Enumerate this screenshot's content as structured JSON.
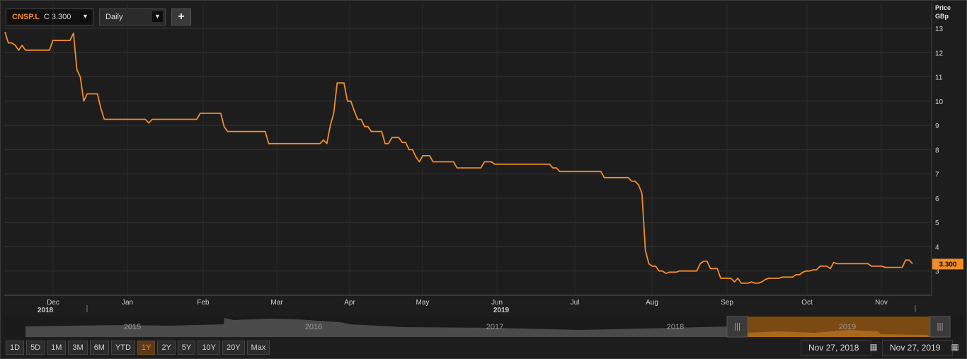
{
  "toolbar": {
    "symbol": "CNSP.L",
    "close_prefix": "C",
    "close_value": "3.300",
    "interval": "Daily",
    "add_label": "+"
  },
  "axis_header": {
    "line1": "Price",
    "line2": "GBp"
  },
  "navigator": {
    "years": [
      "2015",
      "2016",
      "2017",
      "2018",
      "2019"
    ]
  },
  "range_buttons": [
    "1D",
    "5D",
    "1M",
    "3M",
    "6M",
    "YTD",
    "1Y",
    "2Y",
    "5Y",
    "10Y",
    "20Y",
    "Max"
  ],
  "active_range": "1Y",
  "date_range": {
    "start": "Nov 27, 2018",
    "end": "Nov 27, 2019"
  },
  "colors": {
    "series": "#f28c28",
    "background": "#1d1d1d",
    "grid": "#333333"
  },
  "icons": [
    "dropdown-arrow-icon",
    "plus-icon",
    "calendar-icon",
    "navigator-handle-icon"
  ],
  "chart_data": {
    "type": "line",
    "title": "",
    "xlabel": "",
    "ylabel": "Price GBp",
    "ylim": [
      2,
      13
    ],
    "yticks": [
      3,
      4,
      5,
      6,
      7,
      8,
      9,
      10,
      11,
      12,
      13
    ],
    "month_ticks": [
      "Dec",
      "Jan",
      "Feb",
      "Mar",
      "Apr",
      "May",
      "Jun",
      "Jul",
      "Aug",
      "Sep",
      "Oct",
      "Nov"
    ],
    "year_labels": [
      "2018",
      "2019"
    ],
    "last_value": "3.300",
    "grid": true,
    "series": [
      {
        "values": [
          12.85,
          12.4,
          12.4,
          12.3,
          12.1,
          12.3,
          12.1,
          12.1,
          12.1,
          12.1,
          12.1,
          12.1,
          12.1,
          12.1,
          12.5,
          12.5,
          12.5,
          12.5,
          12.5,
          12.5,
          12.8,
          11.3,
          11.0,
          10.0,
          10.3,
          10.3,
          10.3,
          10.3,
          9.7,
          9.25,
          9.25,
          9.25,
          9.25,
          9.25,
          9.25,
          9.25,
          9.25,
          9.25,
          9.25,
          9.25,
          9.25,
          9.25,
          9.1,
          9.25,
          9.25,
          9.25,
          9.25,
          9.25,
          9.25,
          9.25,
          9.25,
          9.25,
          9.25,
          9.25,
          9.25,
          9.25,
          9.25,
          9.5,
          9.5,
          9.5,
          9.5,
          9.5,
          9.5,
          9.5,
          8.95,
          8.75,
          8.75,
          8.75,
          8.75,
          8.75,
          8.75,
          8.75,
          8.75,
          8.75,
          8.75,
          8.75,
          8.75,
          8.25,
          8.25,
          8.25,
          8.25,
          8.25,
          8.25,
          8.25,
          8.25,
          8.25,
          8.25,
          8.25,
          8.25,
          8.25,
          8.25,
          8.25,
          8.25,
          8.4,
          8.25,
          9.0,
          9.5,
          10.75,
          10.75,
          10.75,
          10.0,
          10.0,
          9.6,
          9.25,
          9.25,
          8.95,
          8.95,
          8.75,
          8.75,
          8.75,
          8.75,
          8.25,
          8.25,
          8.5,
          8.5,
          8.5,
          8.3,
          8.3,
          8.0,
          8.0,
          7.7,
          7.5,
          7.75,
          7.75,
          7.75,
          7.5,
          7.5,
          7.5,
          7.5,
          7.5,
          7.5,
          7.5,
          7.25,
          7.25,
          7.25,
          7.25,
          7.25,
          7.25,
          7.25,
          7.25,
          7.5,
          7.5,
          7.5,
          7.4,
          7.4,
          7.4,
          7.4,
          7.4,
          7.4,
          7.4,
          7.4,
          7.4,
          7.4,
          7.4,
          7.4,
          7.4,
          7.4,
          7.4,
          7.4,
          7.4,
          7.25,
          7.25,
          7.1,
          7.1,
          7.1,
          7.1,
          7.1,
          7.1,
          7.1,
          7.1,
          7.1,
          7.1,
          7.1,
          7.1,
          7.1,
          6.85,
          6.85,
          6.85,
          6.85,
          6.85,
          6.85,
          6.85,
          6.85,
          6.7,
          6.7,
          6.55,
          6.2,
          3.85,
          3.3,
          3.2,
          3.2,
          3.0,
          3.0,
          2.9,
          2.95,
          2.95,
          2.95,
          3.0,
          3.0,
          3.0,
          3.0,
          3.0,
          3.0,
          3.3,
          3.4,
          3.4,
          3.1,
          3.1,
          3.1,
          2.7,
          2.7,
          2.7,
          2.7,
          2.55,
          2.7,
          2.5,
          2.5,
          2.5,
          2.55,
          2.5,
          2.5,
          2.55,
          2.65,
          2.7,
          2.7,
          2.7,
          2.7,
          2.75,
          2.75,
          2.75,
          2.75,
          2.85,
          2.85,
          2.95,
          3.0,
          3.0,
          3.05,
          3.05,
          3.2,
          3.2,
          3.2,
          3.1,
          3.35,
          3.3,
          3.3,
          3.3,
          3.3,
          3.3,
          3.3,
          3.3,
          3.3,
          3.3,
          3.3,
          3.2,
          3.2,
          3.2,
          3.2,
          3.15,
          3.15,
          3.15,
          3.15,
          3.15,
          3.15,
          3.45,
          3.45,
          3.3
        ]
      }
    ]
  }
}
